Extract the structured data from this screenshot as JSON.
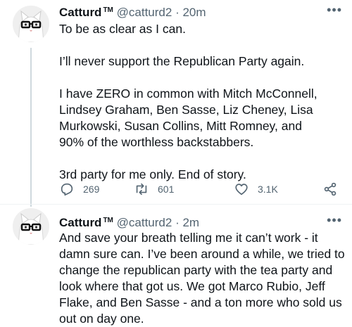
{
  "tweets": [
    {
      "name": "Catturd",
      "tm": "TM",
      "handle": "@catturd2",
      "separator": "·",
      "time": "20m",
      "paragraphs": [
        "To be as clear as I can.",
        "I’ll never support the Republican Party again.",
        "I have ZERO in common with Mitch McConnell, Lindsey Graham, Ben Sasse, Liz Cheney, Lisa Murkowski, Susan Collins, Mitt Romney, and 90% of the worthless backstabbers.",
        "3rd party for me only. End of story."
      ],
      "replies": "269",
      "retweets": "601",
      "likes": "3.1K"
    },
    {
      "name": "Catturd",
      "tm": "TM",
      "handle": "@catturd2",
      "separator": "·",
      "time": "2m",
      "paragraphs": [
        "And save your breath telling me it can’t work - it damn sure can. I’ve been around a while, we tried to change the republican party with the tea party and look where that got us. We got Marco Rubio, Jeff Flake, and Ben Sasse - and a ton more who sold us out on day one."
      ]
    }
  ],
  "icons": {
    "more": "more-horizontal-icon",
    "reply": "reply-icon",
    "retweet": "retweet-icon",
    "like": "heart-icon",
    "share": "share-icon"
  },
  "colors": {
    "text": "#0f1419",
    "secondary": "#536471",
    "thread_line": "#cfd9de"
  }
}
